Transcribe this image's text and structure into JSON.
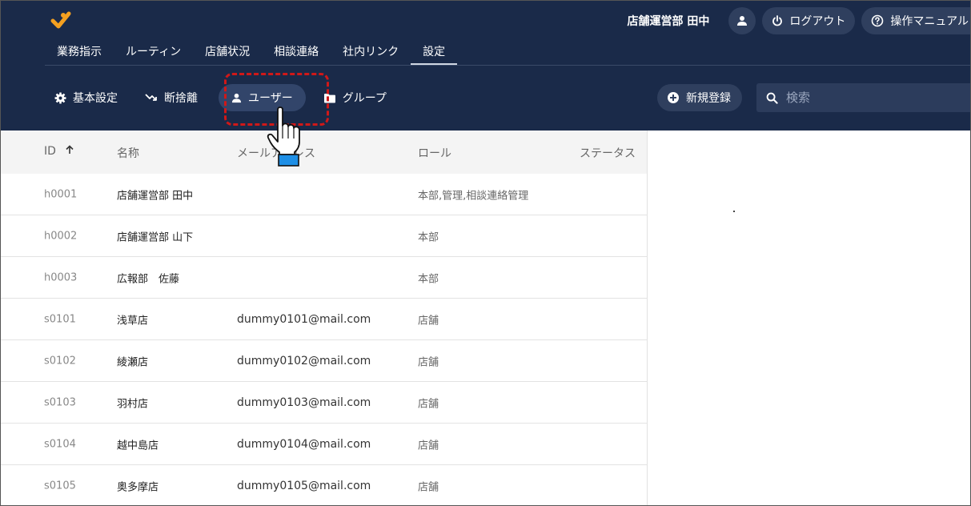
{
  "header": {
    "user_name": "店舗運営部 田中",
    "logout_label": "ログアウト",
    "manual_label": "操作マニュアル"
  },
  "main_nav": [
    {
      "label": "業務指示"
    },
    {
      "label": "ルーティン"
    },
    {
      "label": "店舗状況"
    },
    {
      "label": "相談連絡"
    },
    {
      "label": "社内リンク"
    },
    {
      "label": "設定"
    }
  ],
  "sub_nav": {
    "basic_settings": "基本設定",
    "disposal": "断捨離",
    "users": "ユーザー",
    "groups": "グループ"
  },
  "new_button_label": "新規登録",
  "search": {
    "placeholder": "検索"
  },
  "table": {
    "columns": {
      "id": "ID",
      "name": "名称",
      "email": "メールアドレス",
      "role": "ロール",
      "status": "ステータス"
    },
    "rows": [
      {
        "id": "h0001",
        "name": "店舗運営部 田中",
        "email": "",
        "role": "本部,管理,相談連絡管理",
        "status": ""
      },
      {
        "id": "h0002",
        "name": "店舗運営部 山下",
        "email": "",
        "role": "本部",
        "status": ""
      },
      {
        "id": "h0003",
        "name": "広報部　佐藤",
        "email": "",
        "role": "本部",
        "status": ""
      },
      {
        "id": "s0101",
        "name": "浅草店",
        "email": "dummy0101@mail.com",
        "role": "店舗",
        "status": ""
      },
      {
        "id": "s0102",
        "name": "綾瀬店",
        "email": "dummy0102@mail.com",
        "role": "店舗",
        "status": ""
      },
      {
        "id": "s0103",
        "name": "羽村店",
        "email": "dummy0103@mail.com",
        "role": "店舗",
        "status": ""
      },
      {
        "id": "s0104",
        "name": "越中島店",
        "email": "dummy0104@mail.com",
        "role": "店舗",
        "status": ""
      },
      {
        "id": "s0105",
        "name": "奥多摩店",
        "email": "dummy0105@mail.com",
        "role": "店舗",
        "status": ""
      }
    ]
  },
  "colors": {
    "header_bg": "#1a2a49",
    "pill_bg": "#2f3f5e",
    "logo_orange": "#f4a020",
    "highlight_red": "#d01818",
    "cursor_blue": "#1e8fe6"
  }
}
